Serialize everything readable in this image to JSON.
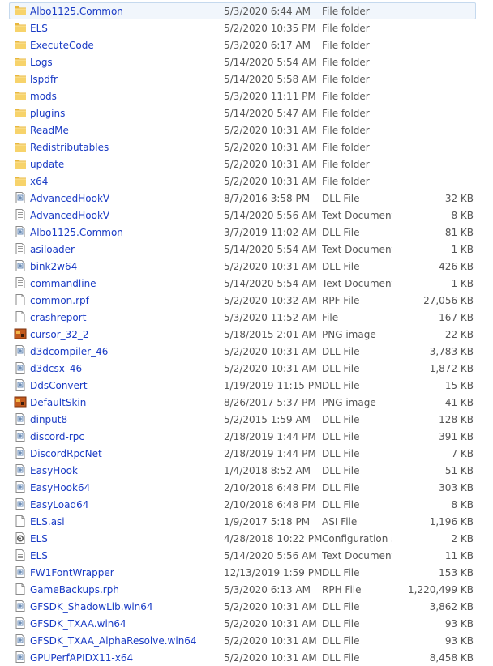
{
  "files": [
    {
      "name": "Albo1125.Common",
      "date": "5/3/2020 6:44 AM",
      "type": "File folder",
      "size": "",
      "icon": "folder-icon",
      "selected": true
    },
    {
      "name": "ELS",
      "date": "5/2/2020 10:35 PM",
      "type": "File folder",
      "size": "",
      "icon": "folder-icon"
    },
    {
      "name": "ExecuteCode",
      "date": "5/3/2020 6:17 AM",
      "type": "File folder",
      "size": "",
      "icon": "folder-icon"
    },
    {
      "name": "Logs",
      "date": "5/14/2020 5:54 AM",
      "type": "File folder",
      "size": "",
      "icon": "folder-icon"
    },
    {
      "name": "lspdfr",
      "date": "5/14/2020 5:58 AM",
      "type": "File folder",
      "size": "",
      "icon": "folder-icon"
    },
    {
      "name": "mods",
      "date": "5/3/2020 11:11 PM",
      "type": "File folder",
      "size": "",
      "icon": "folder-icon"
    },
    {
      "name": "plugins",
      "date": "5/14/2020 5:47 AM",
      "type": "File folder",
      "size": "",
      "icon": "folder-icon"
    },
    {
      "name": "ReadMe",
      "date": "5/2/2020 10:31 AM",
      "type": "File folder",
      "size": "",
      "icon": "folder-icon"
    },
    {
      "name": "Redistributables",
      "date": "5/2/2020 10:31 AM",
      "type": "File folder",
      "size": "",
      "icon": "folder-icon"
    },
    {
      "name": "update",
      "date": "5/2/2020 10:31 AM",
      "type": "File folder",
      "size": "",
      "icon": "folder-icon"
    },
    {
      "name": "x64",
      "date": "5/2/2020 10:31 AM",
      "type": "File folder",
      "size": "",
      "icon": "folder-icon"
    },
    {
      "name": "AdvancedHookV",
      "date": "8/7/2016 3:58 PM",
      "type": "DLL File",
      "size": "32 KB",
      "icon": "dll-file-icon"
    },
    {
      "name": "AdvancedHookV",
      "date": "5/14/2020 5:56 AM",
      "type": "Text Document",
      "size": "8 KB",
      "icon": "text-file-icon"
    },
    {
      "name": "Albo1125.Common",
      "date": "3/7/2019 11:02 AM",
      "type": "DLL File",
      "size": "81 KB",
      "icon": "dll-file-icon"
    },
    {
      "name": "asiloader",
      "date": "5/14/2020 5:54 AM",
      "type": "Text Document",
      "size": "1 KB",
      "icon": "text-file-icon"
    },
    {
      "name": "bink2w64",
      "date": "5/2/2020 10:31 AM",
      "type": "DLL File",
      "size": "426 KB",
      "icon": "dll-file-icon"
    },
    {
      "name": "commandline",
      "date": "5/14/2020 5:54 AM",
      "type": "Text Document",
      "size": "1 KB",
      "icon": "text-file-icon"
    },
    {
      "name": "common.rpf",
      "date": "5/2/2020 10:32 AM",
      "type": "RPF File",
      "size": "27,056 KB",
      "icon": "blank-file-icon"
    },
    {
      "name": "crashreport",
      "date": "5/3/2020 11:52 AM",
      "type": "File",
      "size": "167 KB",
      "icon": "blank-file-icon"
    },
    {
      "name": "cursor_32_2",
      "date": "5/18/2015 2:01 AM",
      "type": "PNG image",
      "size": "22 KB",
      "icon": "image-file-icon"
    },
    {
      "name": "d3dcompiler_46",
      "date": "5/2/2020 10:31 AM",
      "type": "DLL File",
      "size": "3,783 KB",
      "icon": "dll-file-icon"
    },
    {
      "name": "d3dcsx_46",
      "date": "5/2/2020 10:31 AM",
      "type": "DLL File",
      "size": "1,872 KB",
      "icon": "dll-file-icon"
    },
    {
      "name": "DdsConvert",
      "date": "1/19/2019 11:15 PM",
      "type": "DLL File",
      "size": "15 KB",
      "icon": "dll-file-icon"
    },
    {
      "name": "DefaultSkin",
      "date": "8/26/2017 5:37 PM",
      "type": "PNG image",
      "size": "41 KB",
      "icon": "image-file-icon"
    },
    {
      "name": "dinput8",
      "date": "5/2/2015 1:59 AM",
      "type": "DLL File",
      "size": "128 KB",
      "icon": "dll-file-icon"
    },
    {
      "name": "discord-rpc",
      "date": "2/18/2019 1:44 PM",
      "type": "DLL File",
      "size": "391 KB",
      "icon": "dll-file-icon"
    },
    {
      "name": "DiscordRpcNet",
      "date": "2/18/2019 1:44 PM",
      "type": "DLL File",
      "size": "7 KB",
      "icon": "dll-file-icon"
    },
    {
      "name": "EasyHook",
      "date": "1/4/2018 8:52 AM",
      "type": "DLL File",
      "size": "51 KB",
      "icon": "dll-file-icon"
    },
    {
      "name": "EasyHook64",
      "date": "2/10/2018 6:48 PM",
      "type": "DLL File",
      "size": "303 KB",
      "icon": "dll-file-icon"
    },
    {
      "name": "EasyLoad64",
      "date": "2/10/2018 6:48 PM",
      "type": "DLL File",
      "size": "8 KB",
      "icon": "dll-file-icon"
    },
    {
      "name": "ELS.asi",
      "date": "1/9/2017 5:18 PM",
      "type": "ASI File",
      "size": "1,196 KB",
      "icon": "blank-file-icon"
    },
    {
      "name": "ELS",
      "date": "4/28/2018 10:22 PM",
      "type": "Configuration sett...",
      "size": "2 KB",
      "icon": "config-file-icon"
    },
    {
      "name": "ELS",
      "date": "5/14/2020 5:56 AM",
      "type": "Text Document",
      "size": "11 KB",
      "icon": "text-file-icon"
    },
    {
      "name": "FW1FontWrapper",
      "date": "12/13/2019 1:59 PM",
      "type": "DLL File",
      "size": "153 KB",
      "icon": "dll-file-icon"
    },
    {
      "name": "GameBackups.rph",
      "date": "5/3/2020 6:13 AM",
      "type": "RPH File",
      "size": "1,220,499 KB",
      "icon": "blank-file-icon"
    },
    {
      "name": "GFSDK_ShadowLib.win64",
      "date": "5/2/2020 10:31 AM",
      "type": "DLL File",
      "size": "3,862 KB",
      "icon": "dll-file-icon"
    },
    {
      "name": "GFSDK_TXAA.win64",
      "date": "5/2/2020 10:31 AM",
      "type": "DLL File",
      "size": "93 KB",
      "icon": "dll-file-icon"
    },
    {
      "name": "GFSDK_TXAA_AlphaResolve.win64",
      "date": "5/2/2020 10:31 AM",
      "type": "DLL File",
      "size": "93 KB",
      "icon": "dll-file-icon"
    },
    {
      "name": "GPUPerfAPIDX11-x64",
      "date": "5/2/2020 10:31 AM",
      "type": "DLL File",
      "size": "8,458 KB",
      "icon": "dll-file-icon"
    }
  ]
}
